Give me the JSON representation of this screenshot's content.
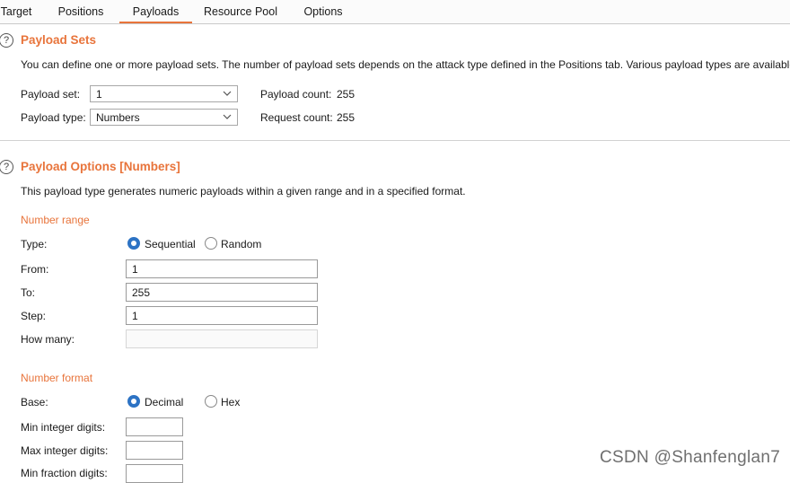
{
  "tabs": [
    {
      "label": "Target",
      "active": false
    },
    {
      "label": "Positions",
      "active": false
    },
    {
      "label": "Payloads",
      "active": true
    },
    {
      "label": "Resource Pool",
      "active": false
    },
    {
      "label": "Options",
      "active": false
    }
  ],
  "accent_color": "#e8743b",
  "radio_color": "#2d73c4",
  "payload_sets": {
    "help_glyph": "?",
    "title": "Payload Sets",
    "description": "You can define one or more payload sets. The number of payload sets depends on the attack type defined in the Positions tab. Various payload types are available",
    "payload_set_label": "Payload set:",
    "payload_set_value": "1",
    "payload_type_label": "Payload type:",
    "payload_type_value": "Numbers",
    "payload_count_label": "Payload count:",
    "payload_count_value": "255",
    "request_count_label": "Request count:",
    "request_count_value": "255"
  },
  "payload_options": {
    "help_glyph": "?",
    "title": "Payload Options [Numbers]",
    "description": "This payload type generates numeric payloads within a given range and in a specified format.",
    "number_range": {
      "heading": "Number range",
      "type_label": "Type:",
      "type_options": [
        "Sequential",
        "Random"
      ],
      "type_selected": "Sequential",
      "from_label": "From:",
      "from_value": "1",
      "to_label": "To:",
      "to_value": "255",
      "step_label": "Step:",
      "step_value": "1",
      "how_many_label": "How many:",
      "how_many_value": ""
    },
    "number_format": {
      "heading": "Number format",
      "base_label": "Base:",
      "base_options": [
        "Decimal",
        "Hex"
      ],
      "base_selected": "Decimal",
      "min_integer_label": "Min integer digits:",
      "max_integer_label": "Max integer digits:",
      "min_fraction_label": "Min fraction digits:"
    }
  },
  "watermark": "CSDN @Shanfenglan7"
}
